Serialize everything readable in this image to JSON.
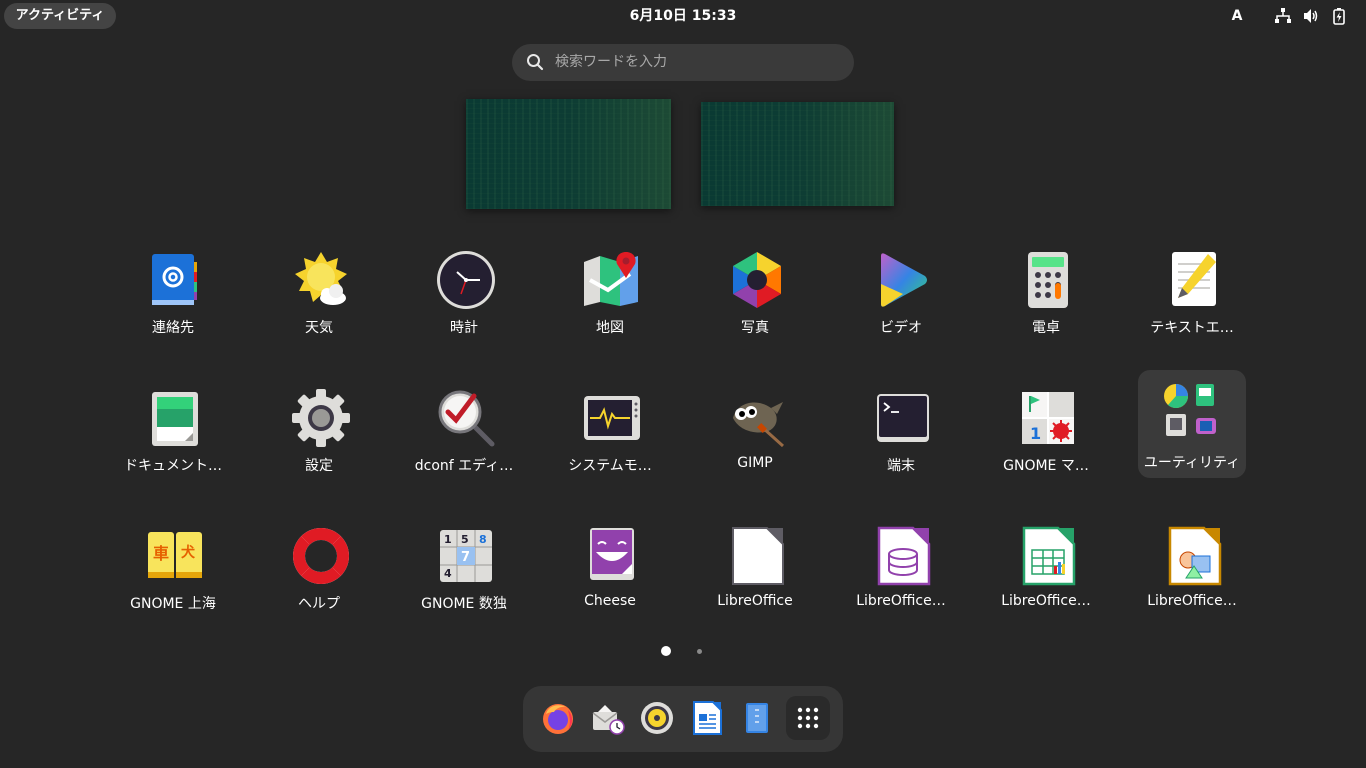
{
  "topbar": {
    "activities_label": "アクティビティ",
    "clock": "6月10日  15:33",
    "input_method": "A",
    "system_icons": [
      "network-icon",
      "volume-icon",
      "battery-icon"
    ]
  },
  "search": {
    "placeholder": "検索ワードを入力",
    "icon": "search-icon"
  },
  "workspaces": [
    "workspace-1",
    "workspace-2"
  ],
  "apps": [
    {
      "label": "連絡先",
      "icon": "contacts-icon"
    },
    {
      "label": "天気",
      "icon": "weather-icon"
    },
    {
      "label": "時計",
      "icon": "clock-icon"
    },
    {
      "label": "地図",
      "icon": "maps-icon"
    },
    {
      "label": "写真",
      "icon": "photos-icon"
    },
    {
      "label": "ビデオ",
      "icon": "video-icon"
    },
    {
      "label": "電卓",
      "icon": "calculator-icon"
    },
    {
      "label": "テキストエ…",
      "icon": "text-editor-icon"
    },
    {
      "label": "ドキュメント…",
      "icon": "document-scanner-icon"
    },
    {
      "label": "設定",
      "icon": "settings-gear-icon"
    },
    {
      "label": "dconf エディ…",
      "icon": "dconf-editor-icon"
    },
    {
      "label": "システムモ…",
      "icon": "system-monitor-icon"
    },
    {
      "label": "GIMP",
      "icon": "gimp-icon"
    },
    {
      "label": "端末",
      "icon": "terminal-icon"
    },
    {
      "label": "GNOME マ…",
      "icon": "mines-icon"
    },
    {
      "label": "ユーティリティ",
      "icon": "utilities-folder-icon"
    },
    {
      "label": "GNOME 上海",
      "icon": "mahjongg-icon"
    },
    {
      "label": "ヘルプ",
      "icon": "help-lifebuoy-icon"
    },
    {
      "label": "GNOME 数独",
      "icon": "sudoku-icon"
    },
    {
      "label": "Cheese",
      "icon": "cheese-icon"
    },
    {
      "label": "LibreOffice",
      "icon": "libreoffice-icon"
    },
    {
      "label": "LibreOffice…",
      "icon": "libreoffice-base-icon"
    },
    {
      "label": "LibreOffice…",
      "icon": "libreoffice-calc-icon"
    },
    {
      "label": "LibreOffice…",
      "icon": "libreoffice-draw-icon"
    }
  ],
  "pagination": {
    "pages": 2,
    "current": 1
  },
  "dock": [
    "firefox-icon",
    "evolution-mail-icon",
    "rhythmbox-icon",
    "libreoffice-writer-icon",
    "file-manager-icon",
    "show-apps-grid-icon"
  ]
}
